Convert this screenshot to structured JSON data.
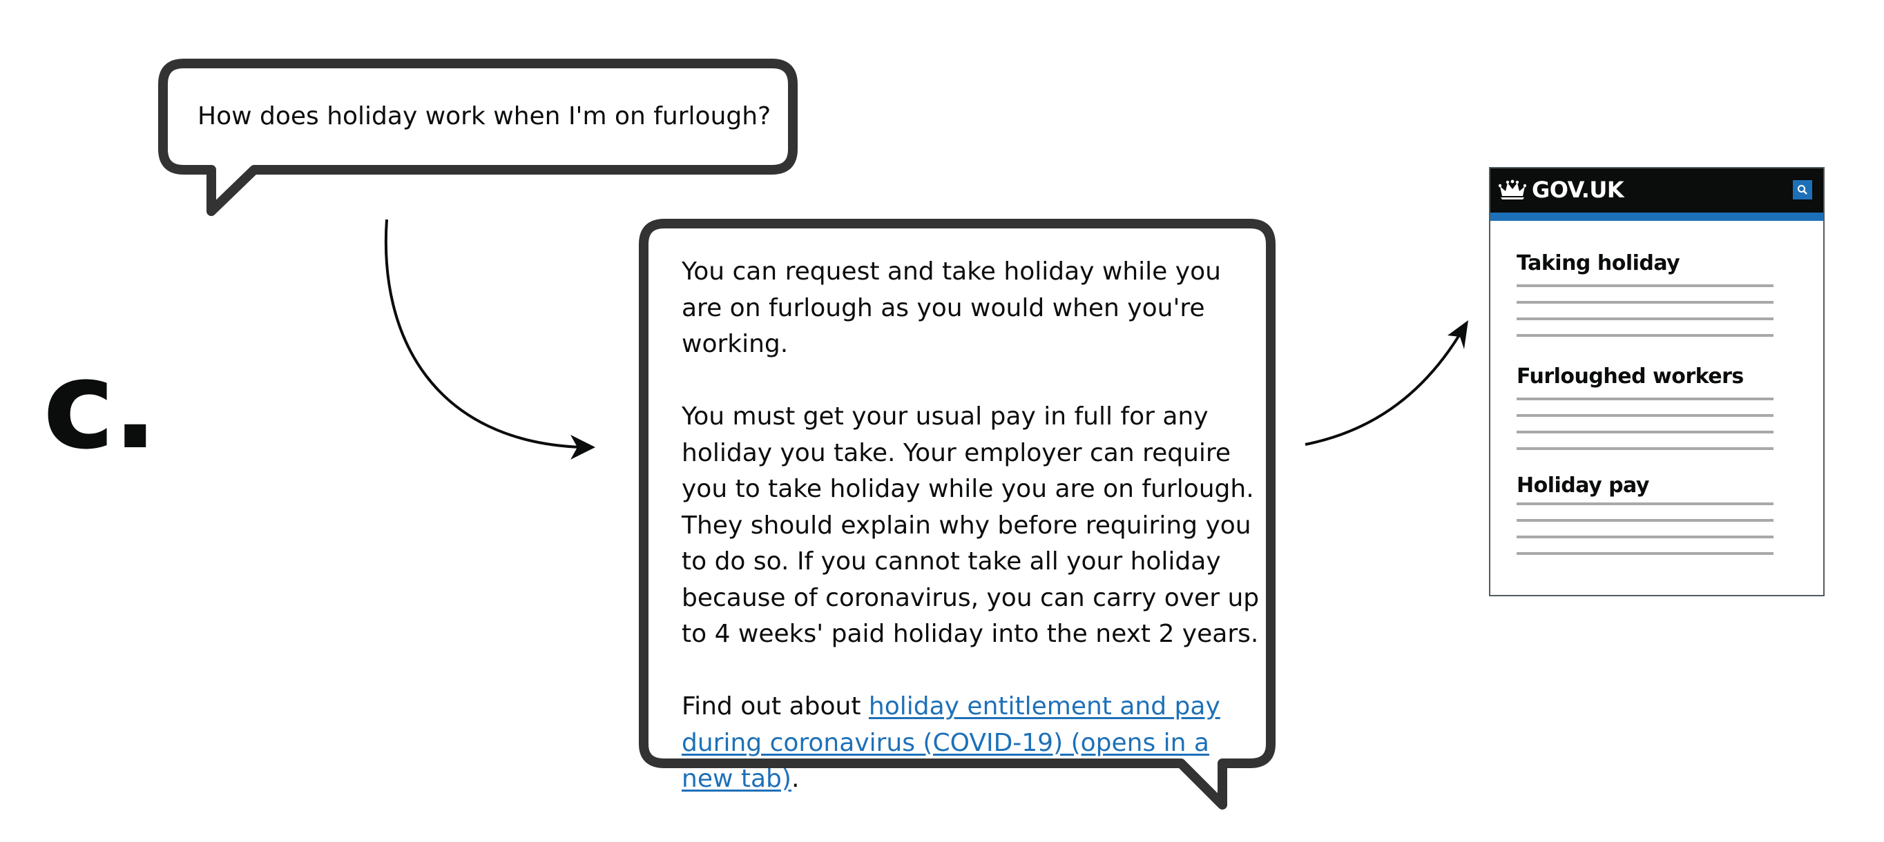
{
  "figure": {
    "label": "c."
  },
  "question_bubble": {
    "text": "How does holiday work when I'm on furlough?"
  },
  "answer_bubble": {
    "paragraph_1": "You can request and take holiday while you are on furlough as you would when you're working.",
    "paragraph_2": "You must get your usual pay in full for any holiday you take. Your employer can require you to take holiday while you are on furlough. They should explain why before requiring you to do so. If you cannot take all your holiday because of coronavirus, you can carry over up to 4 weeks' paid holiday into the next 2 years.",
    "paragraph_3_prefix": "Find out about ",
    "paragraph_3_link": "holiday entitlement and pay during coronavirus (COVID-19) (opens in a new tab)",
    "paragraph_3_suffix": "."
  },
  "govuk_page": {
    "logo_text": "GOV.UK",
    "logo_icon": "crown-icon",
    "search_icon": "search-icon",
    "sections": [
      {
        "heading": "Taking holiday"
      },
      {
        "heading": "Furloughed workers"
      },
      {
        "heading": "Holiday pay"
      }
    ]
  },
  "colors": {
    "link": "#1d70b8",
    "header": "#0b0c0c",
    "brand_bar": "#1d70b8",
    "bubble_border": "#333333",
    "placeholder_lines": "#a8a8a8"
  }
}
